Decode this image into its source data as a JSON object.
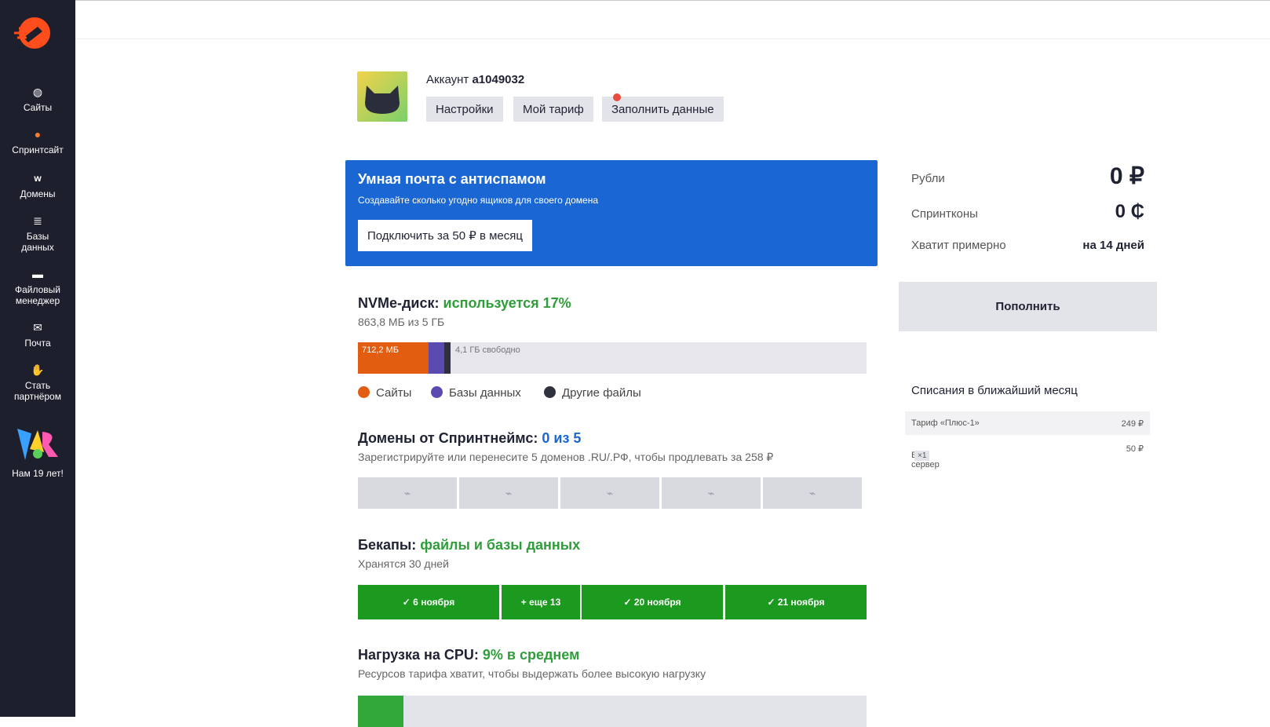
{
  "sidebar": {
    "logo_icon": "rocket-logo-icon",
    "items": [
      {
        "label": "Сайты",
        "icon": "globe-icon"
      },
      {
        "label": "Спринтсайт",
        "icon": "sprintsite-icon"
      },
      {
        "label": "Домены",
        "icon": "domain-icon"
      },
      {
        "label": "Базы данных",
        "icon": "database-icon"
      },
      {
        "label": "Файловый менеджер",
        "icon": "folder-icon"
      },
      {
        "label": "Почта",
        "icon": "mail-icon"
      },
      {
        "label": "Стать партнёром",
        "icon": "handshake-icon"
      }
    ],
    "anniversary": "Нам 19 лет!"
  },
  "account": {
    "prefix": "Аккаунт",
    "id": "a1049032",
    "buttons": {
      "settings": "Настройки",
      "tariff": "Мой тариф",
      "fill": "Заполнить данные"
    }
  },
  "promo": {
    "title": "Умная почта с антиспамом",
    "subtitle": "Создавайте сколько угодно ящиков для своего домена",
    "button": "Подключить за 50 ₽ в месяц",
    "color": "#1a66d2"
  },
  "disk": {
    "title": "NVMe-диск:",
    "usage": "используется 17%",
    "subtitle": "863,8 МБ из 5 ГБ",
    "used_label": "712,2 МБ",
    "free_label": "4,1 ГБ свободно",
    "legend": [
      {
        "label": "Сайты",
        "color": "#e25d10"
      },
      {
        "label": "Базы данных",
        "color": "#5b4ab0"
      },
      {
        "label": "Другие файлы",
        "color": "#30313f"
      }
    ]
  },
  "domains": {
    "title": "Домены от Спринтнеймс:",
    "count": "0 из 5",
    "subtitle": "Зарегистрируйте или перенесите 5 доменов .RU/.РФ, чтобы продлевать за 258 ₽"
  },
  "backups": {
    "title": "Бекапы:",
    "status": "файлы и базы данных",
    "subtitle": "Хранятся 30 дней",
    "items": [
      "✓ 6 ноября",
      "+ еще 13",
      "✓ 20 ноября",
      "✓ 21 ноября"
    ]
  },
  "cpu": {
    "title": "Нагрузка на CPU:",
    "value": "9% в среднем",
    "subtitle": "Ресурсов тарифа хватит, чтобы выдержать более высокую нагрузку",
    "load_fraction": 0.09
  },
  "balance": {
    "rubles_label": "Рубли",
    "rubles_value": "0 ₽",
    "coins_label": "Спринтконы",
    "coins_value": "0 ₵",
    "enough_label": "Хватит примерно",
    "enough_value": "на 14 дней",
    "topup": "Пополнить"
  },
  "charges": {
    "title": "Списания в ближайший месяц",
    "rows": [
      {
        "name": "Тариф «Плюс-1»",
        "amount": "249 ₽"
      },
      {
        "name": "Веб-сервер",
        "chip": "×1",
        "amount": "50 ₽"
      }
    ]
  }
}
